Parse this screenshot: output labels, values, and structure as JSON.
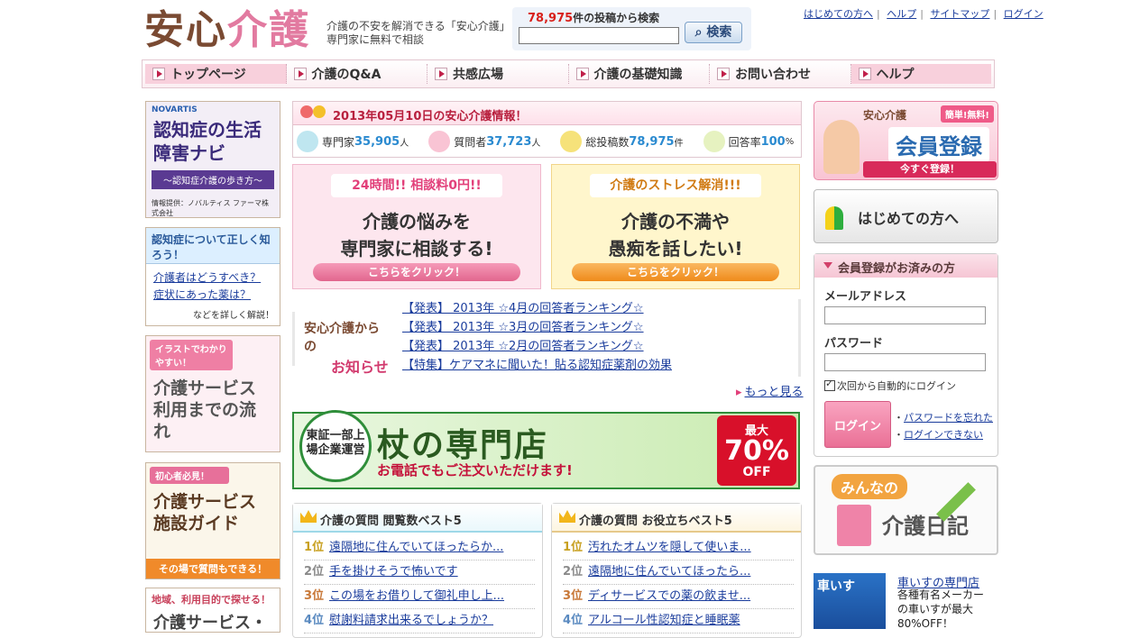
{
  "header": {
    "logo_a": "安心",
    "logo_b": "介護",
    "tagline": "介護の不安を解消できる「安心介護」専門家に無料で相談",
    "search": {
      "count": "78,975",
      "count_suffix": "件の投稿から検索",
      "value": "",
      "button": "検索"
    },
    "toplinks": [
      "はじめての方へ",
      "ヘルプ",
      "サイトマップ",
      "ログイン"
    ]
  },
  "nav": [
    "トップページ",
    "介護のQ&A",
    "共感広場",
    "介護の基礎知識",
    "お問い合わせ",
    "ヘルプ"
  ],
  "left": {
    "b1": {
      "brand": "NOVARTIS",
      "title": "認知症の生活障害ナビ",
      "sub": "〜認知症介護の歩き方〜",
      "credit": "情報提供：ノバルティス ファーマ株式会社"
    },
    "b2": {
      "head": "認知症について正しく知ろう！",
      "link1": "介護者はどうすべき？",
      "link2": "症状にあった薬は？",
      "note": "などを詳しく解説！"
    },
    "b3": {
      "head": "イラストでわかりやすい！",
      "title": "介護サービス利用までの流れ"
    },
    "b4": {
      "head": "初心者必見！",
      "title": "介護サービス施設ガイド",
      "foot": "その場で質問もできる！"
    },
    "b5": {
      "head": "地域、利用目的で探せる！",
      "title": "介護サービス・"
    }
  },
  "info": {
    "title": "2013年05月10日の安心介護情報！",
    "stats": [
      {
        "label": "専門家",
        "value": "35,905",
        "unit": "人"
      },
      {
        "label": "質問者",
        "value": "37,723",
        "unit": "人"
      },
      {
        "label": "総投稿数",
        "value": "78,975",
        "unit": "件"
      },
      {
        "label": "回答率",
        "value": "100",
        "unit": "%"
      }
    ]
  },
  "promo1": {
    "head": "24時間!! 相談料0円!!",
    "body1": "介護の悩みを",
    "body2": "専門家に相談する!",
    "button": "こちらをクリック！"
  },
  "promo2": {
    "head": "介護のストレス解消!!!",
    "body1": "介護の不満や",
    "body2": "愚痴を話したい!",
    "button": "こちらをクリック！"
  },
  "news": {
    "label_a": "安心介護からの",
    "label_b": "お知らせ",
    "items": [
      "【発表】 2013年 ☆4月の回答者ランキング☆",
      "【発表】 2013年 ☆3月の回答者ランキング☆",
      "【発表】 2013年 ☆2月の回答者ランキング☆",
      "【特集】ケアマネに聞いた！貼る認知症薬剤の効果"
    ],
    "more": "もっと見る"
  },
  "cane": {
    "badge": "東証一部上場企業運営",
    "title": "杖の専門店",
    "call": "お電話でもご注文いただけます!",
    "sale_a": "最大",
    "sale_b": "70%",
    "sale_c": "OFF"
  },
  "rank1": {
    "title": "介護の質問 閲覧数ベスト5",
    "items": [
      {
        "pos": "1位",
        "text": "遠隔地に住んでいてほったらか..."
      },
      {
        "pos": "2位",
        "text": "手を掛けそうで怖いです"
      },
      {
        "pos": "3位",
        "text": "この場をお借りして御礼申し上..."
      },
      {
        "pos": "4位",
        "text": "慰謝料請求出来るでしょうか？"
      }
    ]
  },
  "rank2": {
    "title": "介護の質問 お役立ちベスト5",
    "items": [
      {
        "pos": "1位",
        "text": "汚れたオムツを隠して使いま..."
      },
      {
        "pos": "2位",
        "text": "遠隔地に住んでいてほったら..."
      },
      {
        "pos": "3位",
        "text": "ディサービスでの薬の飲ませ..."
      },
      {
        "pos": "4位",
        "text": "アルコール性認知症と睡眠薬"
      }
    ]
  },
  "right": {
    "signup": {
      "brand": "安心介護",
      "badge": "簡単!無料!",
      "big": "会員登録",
      "go": "今すぐ登録！"
    },
    "firsttime": "はじめての方へ",
    "login": {
      "head": "会員登録がお済みの方",
      "email_label": "メールアドレス",
      "password_label": "パスワード",
      "auto": "次回から自動的にログイン",
      "button": "ログイン",
      "forgot": "パスワードを忘れた",
      "cant": "ログインできない"
    },
    "diary": {
      "pill": "みんなの",
      "title": "介護日記"
    },
    "wheel": {
      "img": "車いす",
      "link": "車いすの専門店",
      "desc": "各種有名メーカーの車いすが最大80%OFF！"
    }
  }
}
